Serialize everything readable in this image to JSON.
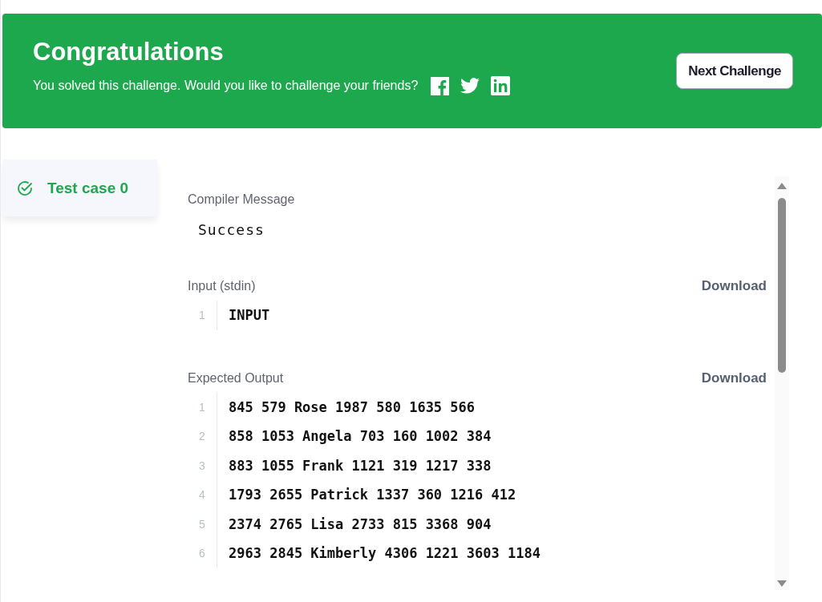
{
  "banner": {
    "title": "Congratulations",
    "message": "You solved this challenge. Would you like to challenge your friends?",
    "button": "Next Challenge"
  },
  "test_cases": [
    {
      "label": "Test case 0",
      "passed": true,
      "selected": true
    }
  ],
  "sections": [
    {
      "kind": "message",
      "label": "Compiler Message",
      "text": "Success"
    },
    {
      "kind": "code",
      "label": "Input (stdin)",
      "action": "Download",
      "lines": [
        {
          "number": "1",
          "text": "INPUT"
        }
      ]
    },
    {
      "kind": "code",
      "label": "Expected Output",
      "action": "Download",
      "lines": [
        {
          "number": "1",
          "text": "845 579 Rose 1987 580 1635 566"
        },
        {
          "number": "2",
          "text": "858 1053 Angela 703 160 1002 384"
        },
        {
          "number": "3",
          "text": "883 1055 Frank 1121 319 1217 338"
        },
        {
          "number": "4",
          "text": "1793 2655 Patrick 1337 360 1216 412"
        },
        {
          "number": "5",
          "text": "2374 2765 Lisa 2733 815 3368 904"
        },
        {
          "number": "6",
          "text": "2963 2845 Kimberly 4306 1221 3603 1184"
        }
      ]
    }
  ]
}
